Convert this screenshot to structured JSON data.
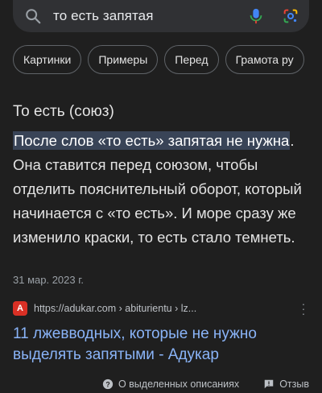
{
  "search": {
    "query": "то есть запятая",
    "icons": [
      "search-icon",
      "microphone-icon",
      "google-lens-icon"
    ]
  },
  "chips": [
    "Картинки",
    "Примеры",
    "Перед",
    "Грамота ру"
  ],
  "featured_snippet": {
    "title": "То есть (союз)",
    "highlight": "После слов «то есть» запятая не нужна",
    "text": ". Она ставится перед союзом, чтобы отделить пояснительный оборот, который начинается с «то есть». И море сразу же изменило краски, то есть стало темнеть.",
    "date": "31 мар. 2023 г."
  },
  "result": {
    "favicon_letter": "A",
    "url": "https://adukar.com › abiturientu › lz...",
    "title": "11 лжевводных, которые не нужно выделять запятыми - Адукар"
  },
  "footer": {
    "about_label": "О выделенных описаниях",
    "feedback_label": "Отзыв"
  },
  "colors": {
    "background": "#1f1f1f",
    "link": "#8ab4f8",
    "highlight": "#394457",
    "favicon": "#d93025"
  }
}
